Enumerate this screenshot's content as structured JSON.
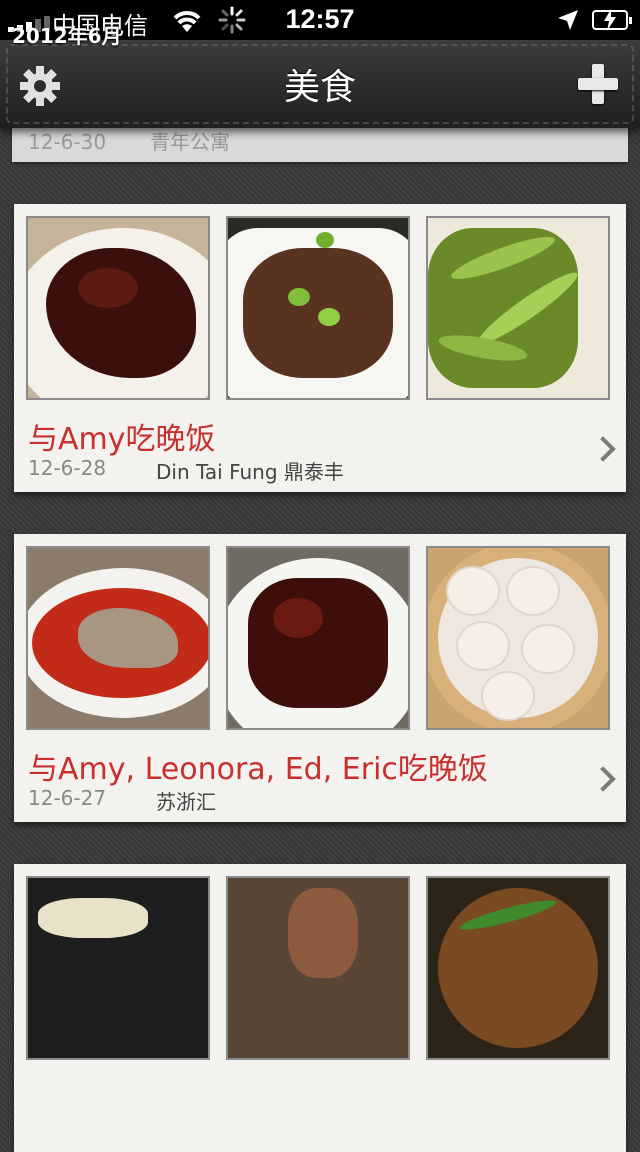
{
  "status_bar": {
    "carrier": "中国电信",
    "time": "12:57",
    "icons": [
      "signal-icon",
      "wifi-icon",
      "activity-spinner-icon",
      "location-arrow-icon",
      "battery-charging-icon"
    ]
  },
  "nav": {
    "title": "美食",
    "left_icon": "gear-icon",
    "right_icon": "plus-icon"
  },
  "section": {
    "ghost_date": "12-6-30",
    "ghost_place": "青年公寓",
    "title": "2012年6月"
  },
  "entries": [
    {
      "title": "与Amy吃晚饭",
      "date": "12-6-28",
      "place": "Din Tai Fung 鼎泰丰",
      "photos": [
        "braised-pork-ribs",
        "braised-gluten-with-edamame",
        "edamame-in-sauce"
      ]
    },
    {
      "title": "与Amy, Leonora, Ed, Eric吃晚饭",
      "date": "12-6-27",
      "place": "苏浙汇",
      "photos": [
        "steamed-fish-in-chili-sauce",
        "braised-pork-belly",
        "xiaolongbao-steamer"
      ]
    },
    {
      "title": "",
      "date": "",
      "place": "",
      "photos": [
        "dumplings-on-tray",
        "teapot",
        "stir-fried-chives"
      ]
    }
  ],
  "colors": {
    "accent_title": "#c7302c",
    "card_bg": "#f3f2ef",
    "nav_bg": "#2b2b2b"
  }
}
